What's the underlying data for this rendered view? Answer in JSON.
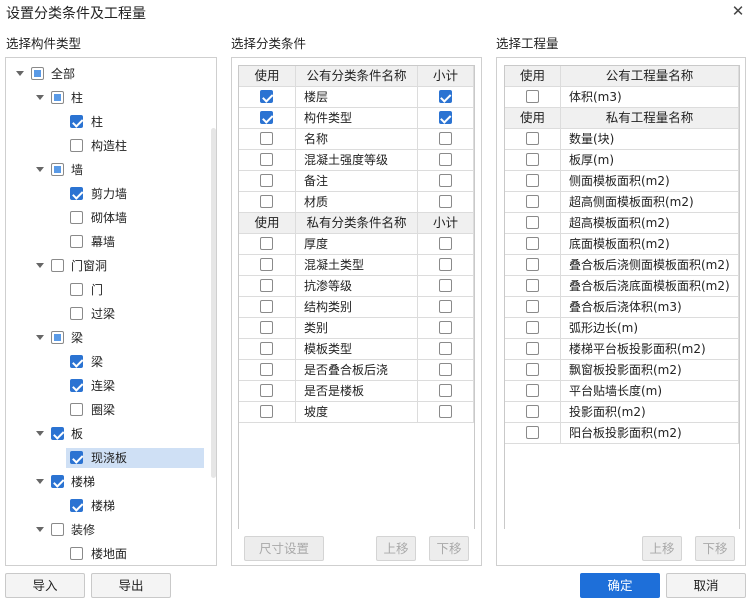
{
  "window": {
    "title": "设置分类条件及工程量",
    "close_glyph": "✕"
  },
  "tree": {
    "label": "选择构件类型",
    "items": [
      {
        "text": "全部",
        "level": 0,
        "expanded": true,
        "state": "partial"
      },
      {
        "text": "柱",
        "level": 1,
        "expanded": true,
        "state": "partial"
      },
      {
        "text": "柱",
        "level": 2,
        "state": "checked"
      },
      {
        "text": "构造柱",
        "level": 2,
        "state": "unchecked"
      },
      {
        "text": "墙",
        "level": 1,
        "expanded": true,
        "state": "partial"
      },
      {
        "text": "剪力墙",
        "level": 2,
        "state": "checked"
      },
      {
        "text": "砌体墙",
        "level": 2,
        "state": "unchecked"
      },
      {
        "text": "幕墙",
        "level": 2,
        "state": "unchecked"
      },
      {
        "text": "门窗洞",
        "level": 1,
        "expanded": true,
        "state": "unchecked"
      },
      {
        "text": "门",
        "level": 2,
        "state": "unchecked"
      },
      {
        "text": "过梁",
        "level": 2,
        "state": "unchecked"
      },
      {
        "text": "梁",
        "level": 1,
        "expanded": true,
        "state": "partial"
      },
      {
        "text": "梁",
        "level": 2,
        "state": "checked"
      },
      {
        "text": "连梁",
        "level": 2,
        "state": "checked"
      },
      {
        "text": "圈梁",
        "level": 2,
        "state": "unchecked"
      },
      {
        "text": "板",
        "level": 1,
        "expanded": true,
        "state": "checked"
      },
      {
        "text": "现浇板",
        "level": 2,
        "state": "checked",
        "selected": true
      },
      {
        "text": "楼梯",
        "level": 1,
        "expanded": true,
        "state": "checked"
      },
      {
        "text": "楼梯",
        "level": 2,
        "state": "checked"
      },
      {
        "text": "装修",
        "level": 1,
        "expanded": true,
        "state": "unchecked"
      },
      {
        "text": "楼地面",
        "level": 2,
        "state": "unchecked"
      }
    ],
    "import_label": "导入",
    "export_label": "导出"
  },
  "conditions": {
    "label": "选择分类条件",
    "public_header": {
      "use": "使用",
      "name": "公有分类条件名称",
      "subtotal": "小计"
    },
    "public_rows": [
      {
        "name": "楼层",
        "use": true,
        "subtotal": true
      },
      {
        "name": "构件类型",
        "use": true,
        "subtotal": true
      },
      {
        "name": "名称",
        "use": false,
        "subtotal": false
      },
      {
        "name": "混凝土强度等级",
        "use": false,
        "subtotal": false
      },
      {
        "name": "备注",
        "use": false,
        "subtotal": false
      },
      {
        "name": "材质",
        "use": false,
        "subtotal": false
      }
    ],
    "private_header": {
      "use": "使用",
      "name": "私有分类条件名称",
      "subtotal": "小计"
    },
    "private_rows": [
      {
        "name": "厚度",
        "use": false,
        "subtotal": false
      },
      {
        "name": "混凝土类型",
        "use": false,
        "subtotal": false
      },
      {
        "name": "抗渗等级",
        "use": false,
        "subtotal": false
      },
      {
        "name": "结构类别",
        "use": false,
        "subtotal": false
      },
      {
        "name": "类别",
        "use": false,
        "subtotal": false
      },
      {
        "name": "模板类型",
        "use": false,
        "subtotal": false
      },
      {
        "name": "是否叠合板后浇",
        "use": false,
        "subtotal": false
      },
      {
        "name": "是否是楼板",
        "use": false,
        "subtotal": false
      },
      {
        "name": "坡度",
        "use": false,
        "subtotal": false
      }
    ],
    "size_button": "尺寸设置",
    "up_button": "上移",
    "down_button": "下移"
  },
  "quantities": {
    "label": "选择工程量",
    "public_header": {
      "use": "使用",
      "name": "公有工程量名称"
    },
    "public_rows": [
      {
        "name": "体积(m3)",
        "use": false
      }
    ],
    "private_header": {
      "use": "使用",
      "name": "私有工程量名称"
    },
    "private_rows": [
      {
        "name": "数量(块)",
        "use": false
      },
      {
        "name": "板厚(m)",
        "use": false
      },
      {
        "name": "侧面模板面积(m2)",
        "use": false
      },
      {
        "name": "超高侧面模板面积(m2)",
        "use": false
      },
      {
        "name": "超高模板面积(m2)",
        "use": false
      },
      {
        "name": "底面模板面积(m2)",
        "use": false
      },
      {
        "name": "叠合板后浇侧面模板面积(m2)",
        "use": false
      },
      {
        "name": "叠合板后浇底面模板面积(m2)",
        "use": false
      },
      {
        "name": "叠合板后浇体积(m3)",
        "use": false
      },
      {
        "name": "弧形边长(m)",
        "use": false
      },
      {
        "name": "楼梯平台板投影面积(m2)",
        "use": false
      },
      {
        "name": "飘窗板投影面积(m2)",
        "use": false
      },
      {
        "name": "平台贴墙长度(m)",
        "use": false
      },
      {
        "name": "投影面积(m2)",
        "use": false
      },
      {
        "name": "阳台板投影面积(m2)",
        "use": false
      }
    ],
    "up_button": "上移",
    "down_button": "下移"
  },
  "footer": {
    "ok_label": "确定",
    "cancel_label": "取消"
  }
}
